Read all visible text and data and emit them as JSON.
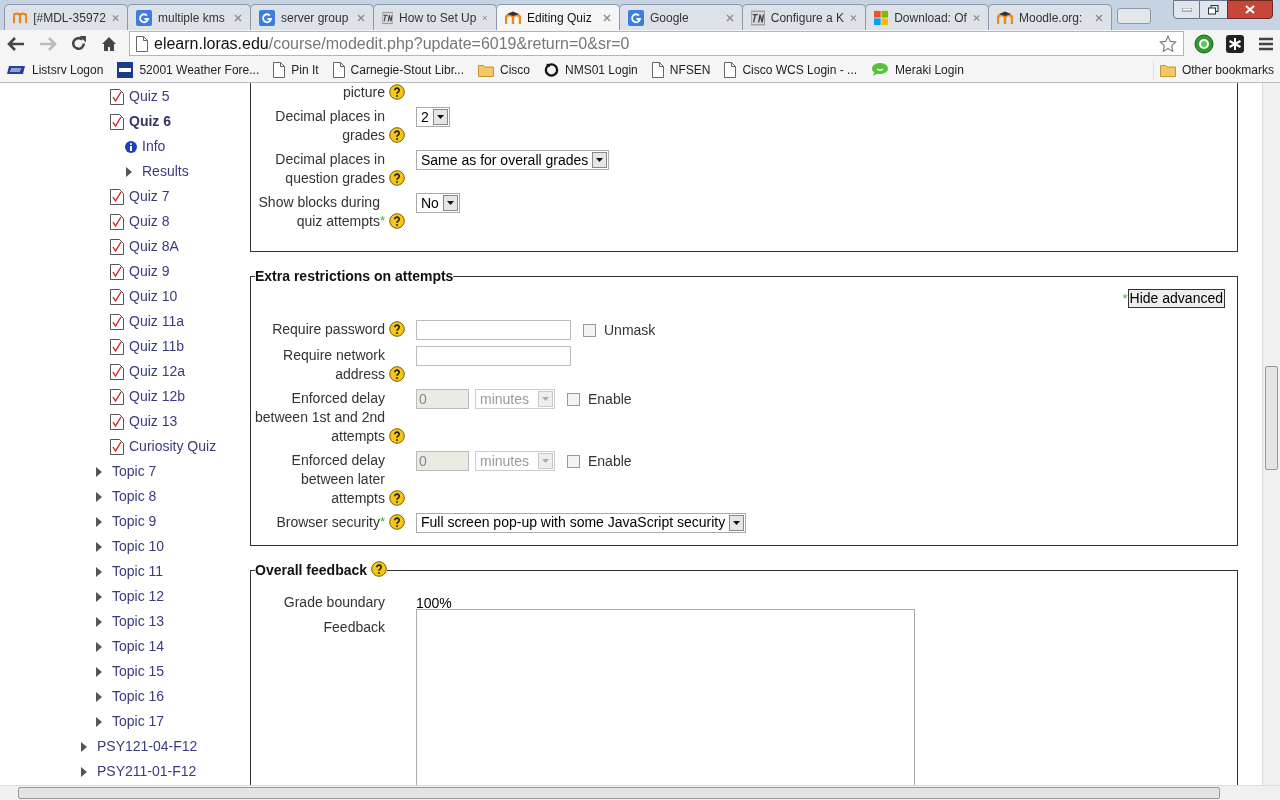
{
  "browser": {
    "tabs": [
      {
        "title": "[#MDL-35972",
        "kind": "moodle",
        "selected": false
      },
      {
        "title": "multiple kms",
        "kind": "google",
        "selected": false
      },
      {
        "title": "server group",
        "kind": "google",
        "selected": false
      },
      {
        "title": "How to Set Up",
        "kind": "tn",
        "selected": false
      },
      {
        "title": "Editing Quiz",
        "kind": "moodle-hat",
        "selected": true
      },
      {
        "title": "Google",
        "kind": "google",
        "selected": false
      },
      {
        "title": "Configure a K",
        "kind": "tn",
        "selected": false
      },
      {
        "title": "Download: Of",
        "kind": "windows",
        "selected": false
      },
      {
        "title": "Moodle.org:",
        "kind": "moodle-hat",
        "selected": false
      }
    ],
    "address": {
      "host": "elearn.loras.edu",
      "path": "/course/modedit.php?update=6019&return=0&sr=0"
    },
    "bookmarks": [
      {
        "label": "Listsrv Logon",
        "kind": "listserv"
      },
      {
        "label": "52001 Weather Fore...",
        "kind": "twc"
      },
      {
        "label": "Pin It",
        "kind": "page"
      },
      {
        "label": "Carnegie-Stout Libr...",
        "kind": "page"
      },
      {
        "label": "Cisco",
        "kind": "folder"
      },
      {
        "label": "NMS01 Login",
        "kind": "ring"
      },
      {
        "label": "NFSEN",
        "kind": "page"
      },
      {
        "label": "Cisco WCS Login - ...",
        "kind": "page"
      },
      {
        "label": "Meraki Login",
        "kind": "chat"
      }
    ],
    "other_bookmarks": "Other bookmarks"
  },
  "sidebar": {
    "items": [
      {
        "children": [
          {
            "children": [
              {
                "kind": "quiz",
                "label": "Quiz 5",
                "selected": false
              },
              {
                "kind": "quiz",
                "label": "Quiz 6",
                "selected": true,
                "children": [
                  {
                    "kind": "info",
                    "label": "Info"
                  },
                  {
                    "kind": "node",
                    "label": "Results",
                    "expanded": false
                  }
                ]
              },
              {
                "kind": "quiz",
                "label": "Quiz 7",
                "selected": false
              },
              {
                "kind": "quiz",
                "label": "Quiz 8",
                "selected": false
              },
              {
                "kind": "quiz",
                "label": "Quiz 8A",
                "selected": false
              },
              {
                "kind": "quiz",
                "label": "Quiz 9",
                "selected": false
              },
              {
                "kind": "quiz",
                "label": "Quiz 10",
                "selected": false
              },
              {
                "kind": "quiz",
                "label": "Quiz 11a",
                "selected": false
              },
              {
                "kind": "quiz",
                "label": "Quiz 11b",
                "selected": false
              },
              {
                "kind": "quiz",
                "label": "Quiz 12a",
                "selected": false
              },
              {
                "kind": "quiz",
                "label": "Quiz 12b",
                "selected": false
              },
              {
                "kind": "quiz",
                "label": "Quiz 13",
                "selected": false
              },
              {
                "kind": "quiz",
                "label": "Curiosity Quiz",
                "selected": false
              }
            ]
          },
          {
            "kind": "node",
            "label": "Topic 7",
            "expanded": false
          },
          {
            "kind": "node",
            "label": "Topic 8",
            "expanded": false
          },
          {
            "kind": "node",
            "label": "Topic 9",
            "expanded": false
          },
          {
            "kind": "node",
            "label": "Topic 10",
            "expanded": false
          },
          {
            "kind": "node",
            "label": "Topic 11",
            "expanded": false
          },
          {
            "kind": "node",
            "label": "Topic 12",
            "expanded": false
          },
          {
            "kind": "node",
            "label": "Topic 13",
            "expanded": false
          },
          {
            "kind": "node",
            "label": "Topic 14",
            "expanded": false
          },
          {
            "kind": "node",
            "label": "Topic 15",
            "expanded": false
          },
          {
            "kind": "node",
            "label": "Topic 16",
            "expanded": false
          },
          {
            "kind": "node",
            "label": "Topic 17",
            "expanded": false
          }
        ]
      },
      {
        "kind": "node",
        "label": "PSY121-04-F12",
        "expanded": false
      },
      {
        "kind": "node",
        "label": "PSY211-01-F12",
        "expanded": false
      }
    ]
  },
  "form": {
    "sections": [
      {
        "rows": [
          {
            "label": "picture",
            "help": true
          },
          {
            "label": "Decimal places in grades",
            "help": true,
            "control": {
              "kind": "select",
              "value": "2",
              "disabled": false
            }
          },
          {
            "label": "Decimal places in question grades",
            "help": true,
            "control": {
              "kind": "select",
              "value": "Same as for overall grades",
              "disabled": false
            }
          },
          {
            "label": "Show blocks during quiz attempts",
            "marker": "*",
            "help": true,
            "control": {
              "kind": "select",
              "value": "No",
              "disabled": false
            }
          }
        ]
      },
      {
        "legend": "Extra restrictions on attempts",
        "advanced_toggle": {
          "marker": "*",
          "label": "Hide advanced"
        },
        "rows": [
          {
            "label": "Require password",
            "help": true,
            "control": {
              "kind": "text",
              "disabled": false
            },
            "checkbox": {
              "label": "Unmask",
              "checked": false
            }
          },
          {
            "label": "Require network address",
            "help": true,
            "control": {
              "kind": "text",
              "disabled": false
            }
          },
          {
            "label": "Enforced delay between 1st and 2nd attempts",
            "help": true,
            "control": {
              "kind": "duration",
              "value": "0",
              "unit": "minutes",
              "disabled": true
            },
            "checkbox": {
              "label": "Enable",
              "checked": false
            }
          },
          {
            "label": "Enforced delay between later attempts",
            "help": true,
            "control": {
              "kind": "duration",
              "value": "0",
              "unit": "minutes",
              "disabled": true
            },
            "checkbox": {
              "label": "Enable",
              "checked": false
            }
          },
          {
            "label": "Browser security",
            "marker": "*",
            "help": true,
            "control": {
              "kind": "select",
              "value": "Full screen pop-up with some JavaScript security",
              "disabled": false
            }
          }
        ]
      },
      {
        "legend": "Overall feedback",
        "legend_help": true,
        "rows": [
          {
            "label": "Grade boundary",
            "control": {
              "kind": "static",
              "value": "100%"
            }
          },
          {
            "label": "Feedback",
            "control": {
              "kind": "textarea"
            }
          }
        ]
      }
    ]
  }
}
